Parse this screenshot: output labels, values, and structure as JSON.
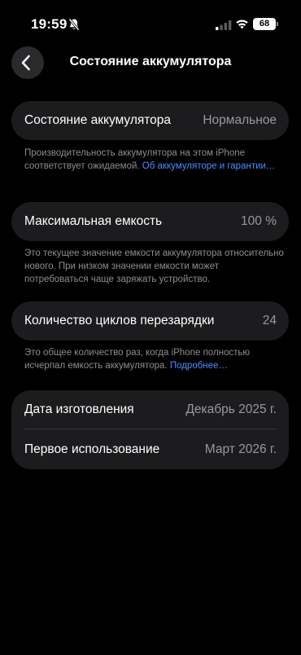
{
  "status_bar": {
    "time": "19:59",
    "battery_level": "68",
    "icons": [
      "bell-slash-icon",
      "cellular-signal-icon",
      "wifi-icon",
      "battery-icon"
    ]
  },
  "nav": {
    "back_icon": "chevron-left-icon",
    "title": "Состояние аккумулятора"
  },
  "battery_health": {
    "label": "Состояние аккумулятора",
    "value": "Нормальное",
    "footnote_text": "Производительность аккумулятора на этом iPhone соответствует ожидаемой. ",
    "footnote_link": "Об аккумуляторе и гарантии…"
  },
  "max_capacity": {
    "label": "Максимальная емкость",
    "value": "100 %",
    "footnote_text": "Это текущее значение емкости аккумулятора относительно нового. При низком значении емкости может потребоваться чаще заряжать устройство."
  },
  "cycle_count": {
    "label": "Количество циклов перезарядки",
    "value": "24",
    "footnote_text": "Это общее количество раз, когда iPhone полностью исчерпал емкость аккумулятора. ",
    "footnote_link": "Подробнее…"
  },
  "dates": {
    "manufacture_label": "Дата изготовления",
    "manufacture_value": "Декабрь 2025 г.",
    "first_use_label": "Первое использование",
    "first_use_value": "Март 2026 г."
  },
  "colors": {
    "background": "#000000",
    "card": "#1c1c1e",
    "secondary_text": "#8e8e93",
    "link": "#4c8dff"
  }
}
